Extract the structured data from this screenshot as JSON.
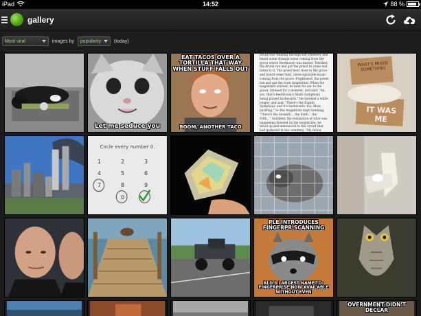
{
  "status_bar": {
    "device": "iPad",
    "time": "14:52",
    "battery": "88 %",
    "battery_level": 0.88
  },
  "app": {
    "title": "gallery"
  },
  "filters": {
    "sort_select": "Most viral",
    "images_by_label": "images by",
    "order_select": "popularity",
    "period_label": "(today)"
  },
  "tiles": [
    {
      "kind": "cat-sleeping"
    },
    {
      "kind": "meme-cat",
      "bottom": "Let me seduce you"
    },
    {
      "kind": "meme-guy",
      "top": "EAT TACOS OVER A TORTILLA THAT WAY WHEN STUFF FALLS OUT",
      "bottom": "BOOM, ANOTHER TACO"
    },
    {
      "kind": "article",
      "text": "drunk was walking through the cemetery and heard some strange noise coming from the grave where Beethoven was buried. Terrified, the drunk ran and got the priest to come and listen to it. The priest bent close to the grave and heard some faint, unrecognizable music coming from the grave. Frightened, the priest ran and got the town magistrate. When the magistrate arrived, he bent his ear to the grave, listened for a moment, and said, \"Ah, yes, that's Beethoven's Ninth Symphony, being played backwards.\" He listened a while longer, and said, \"There's the Eighth Symphony, and it's backwards, too. Most puzzling.\" So the magistrate kept listening; \"There's the Seventh... the Sixth... the Fifth...\" Suddenly the realization of what was happening dawned on the magistrate; he stood up and announced to the crowd that had gathered in the cemetery, \"My fellow citizens, there's nothing to worry about. It's just Beethoven decomposing.\""
    },
    {
      "kind": "signs",
      "sign1": "WHAT'S MIXED SOMETHING",
      "sign2": "IT WAS ME"
    },
    {
      "kind": "city"
    },
    {
      "kind": "numbers-puzzle",
      "caption": "Circle every number 0.",
      "numbers": [
        "1",
        "2",
        "3",
        "4",
        "5",
        "6",
        "7",
        "8",
        "9",
        "0"
      ]
    },
    {
      "kind": "opal"
    },
    {
      "kind": "cage-animal"
    },
    {
      "kind": "dog-hiding"
    },
    {
      "kind": "bruce"
    },
    {
      "kind": "dock-dog"
    },
    {
      "kind": "truck"
    },
    {
      "kind": "meme-raccoon",
      "top": "PLE INTRODUCES FINGERPR SCANNING",
      "bottom": "RLD'S LARGEST NAME-TO-FINGERPR SE NOW AVAILABLE WITHOUT EVEN"
    },
    {
      "kind": "owl"
    },
    {
      "kind": "partial-blue"
    },
    {
      "kind": "partial-brown"
    },
    {
      "kind": "partial-gray"
    },
    {
      "kind": "partial-dark"
    },
    {
      "kind": "meme-partial",
      "top": "OVERNMENT DIDN'T DECLAR"
    }
  ]
}
